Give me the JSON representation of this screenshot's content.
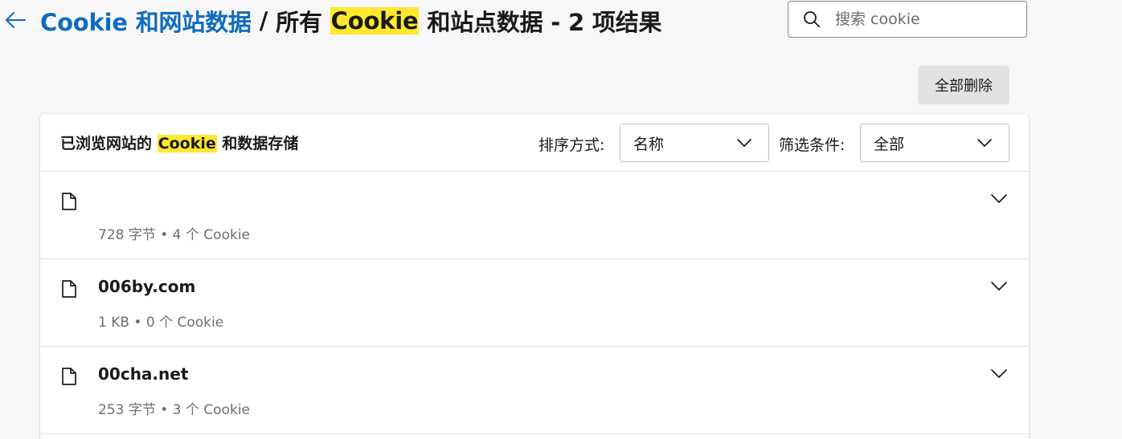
{
  "header": {
    "breadcrumb_link": "Cookie 和网站数据",
    "separator": "/",
    "title_prefix": "所有",
    "title_highlight": "Cookie",
    "title_suffix": "和站点数据 - 2 项结果"
  },
  "search": {
    "placeholder": "搜索 cookie",
    "value": ""
  },
  "actions": {
    "delete_all": "全部删除"
  },
  "card": {
    "title_prefix": "已浏览网站的",
    "title_highlight": "Cookie",
    "title_suffix": "和数据存储",
    "sort_label": "排序方式:",
    "sort_value": "名称",
    "filter_label": "筛选条件:",
    "filter_value": "全部"
  },
  "sites": [
    {
      "name": "",
      "meta": "728 字节 • 4 个 Cookie"
    },
    {
      "name": "006by.com",
      "meta": "1 KB • 0 个 Cookie"
    },
    {
      "name": "00cha.net",
      "meta": "253 字节 • 3 个 Cookie"
    }
  ],
  "colors": {
    "link": "#0f6cbd",
    "highlight": "#ffe82e",
    "background": "#f7f7f7"
  },
  "icons": [
    "back-arrow-icon",
    "search-icon",
    "file-icon",
    "chevron-down-icon"
  ]
}
